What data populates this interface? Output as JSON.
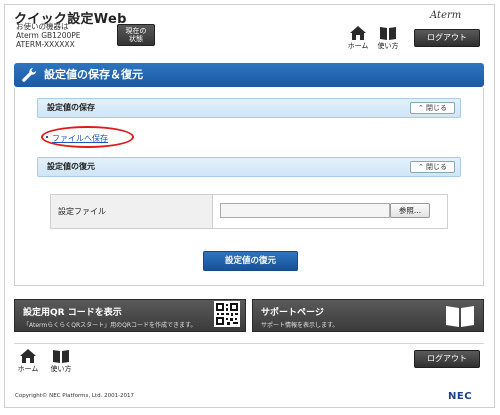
{
  "header": {
    "app_title": "クイック設定Web",
    "device_caption": "お使いの機器は",
    "device_model": "Aterm GB1200PE",
    "device_id": "ATERM-XXXXXX",
    "status_button_line1": "現在の",
    "status_button_line2": "状態",
    "brand": "Aterm",
    "home_label": "ホーム",
    "help_label": "使い方",
    "logout_label": "ログアウト"
  },
  "page": {
    "title": "設定値の保存＆復元"
  },
  "save_section": {
    "title": "設定値の保存",
    "close_label": "閉じる",
    "file_link": "ファイルへ保存"
  },
  "restore_section": {
    "title": "設定値の復元",
    "close_label": "閉じる",
    "field_label": "設定ファイル",
    "file_value": "",
    "browse_label": "参照...",
    "restore_button": "設定値の復元"
  },
  "panels": {
    "qr_title": "設定用QR コードを表示",
    "qr_desc": "「AtermらくらくQRスタート」用のQRコードを作成できます。",
    "support_title": "サポートページ",
    "support_desc": "サポート情報を表示します。"
  },
  "footer": {
    "home_label": "ホーム",
    "help_label": "使い方",
    "logout_label": "ログアウト",
    "copyright": "Copyright© NEC Platforms, Ltd. 2001-2017",
    "nec_logo": "NEC"
  },
  "colors": {
    "accent_blue": "#1a5aa6",
    "section_blue": "#cfe5f6",
    "highlight_red": "#e01818",
    "dark_button": "#3a3a3a"
  }
}
